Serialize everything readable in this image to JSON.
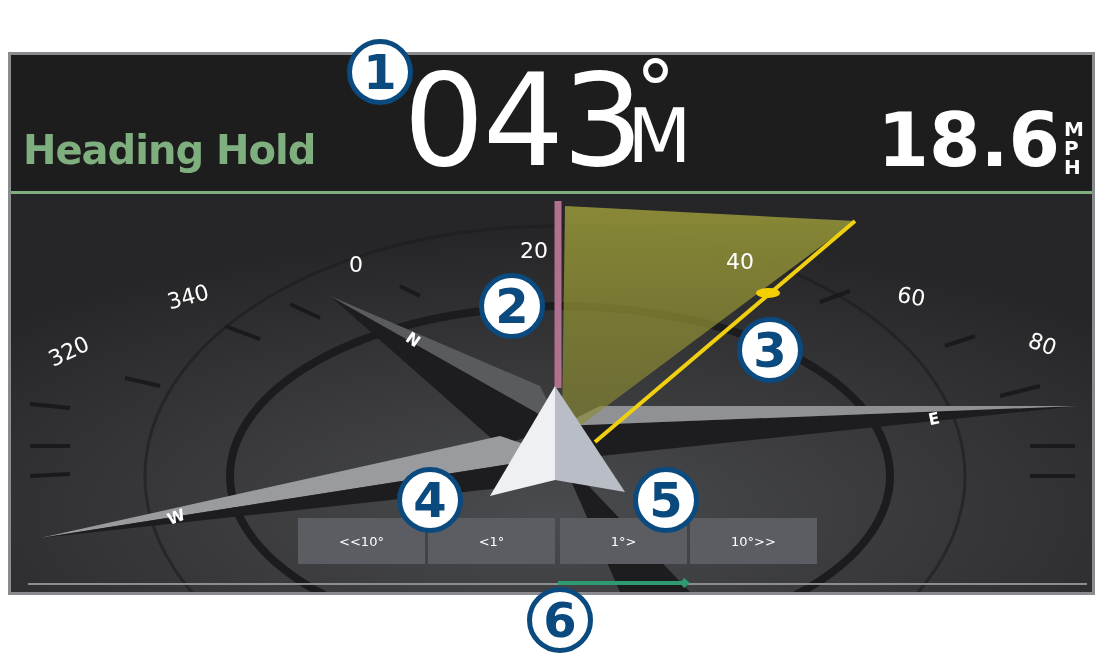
{
  "header": {
    "mode": "Heading Hold",
    "heading": "043",
    "degree_sign": "°",
    "heading_reference": "M",
    "speed": "18.6",
    "speed_unit": "MPH"
  },
  "compass": {
    "scale_labels": [
      "320",
      "340",
      "0",
      "20",
      "40",
      "60",
      "80"
    ],
    "rose_letters": [
      "N",
      "E",
      "W"
    ]
  },
  "buttons": [
    "<<10°",
    "<1°",
    "1°>",
    "10°>>"
  ],
  "callouts": [
    "1",
    "2",
    "3",
    "4",
    "5",
    "6"
  ]
}
